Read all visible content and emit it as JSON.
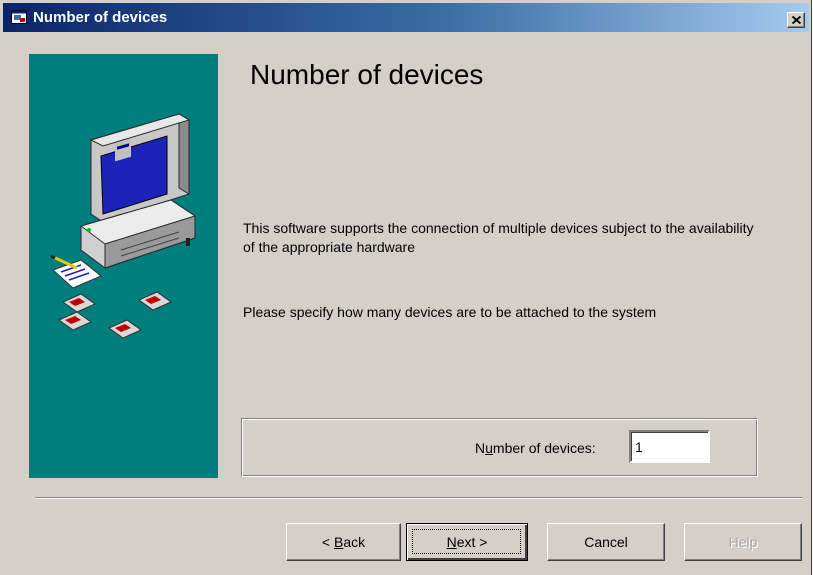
{
  "window": {
    "title": "Number of devices",
    "close_glyph": "×"
  },
  "banner": {
    "illustration": "computer-with-floppies-illustration",
    "color": "#007d7d"
  },
  "content": {
    "heading": "Number of devices",
    "paragraph1": "This software supports the connection of multiple devices subject to the availability of the appropriate hardware",
    "paragraph2": "Please specify how many devices are to be attached to the system"
  },
  "devices_field": {
    "label_pre": "N",
    "label_accel": "u",
    "label_post": "mber of devices:",
    "value": "1"
  },
  "buttons": {
    "back_pre": "< ",
    "back_accel": "B",
    "back_post": "ack",
    "next_accel": "N",
    "next_post": "ext >",
    "cancel": "Cancel",
    "help": "Help"
  },
  "colors": {
    "titlebar_start": "#0a246a",
    "titlebar_end": "#a6caf0",
    "dialog_face": "#d4d0c8"
  }
}
